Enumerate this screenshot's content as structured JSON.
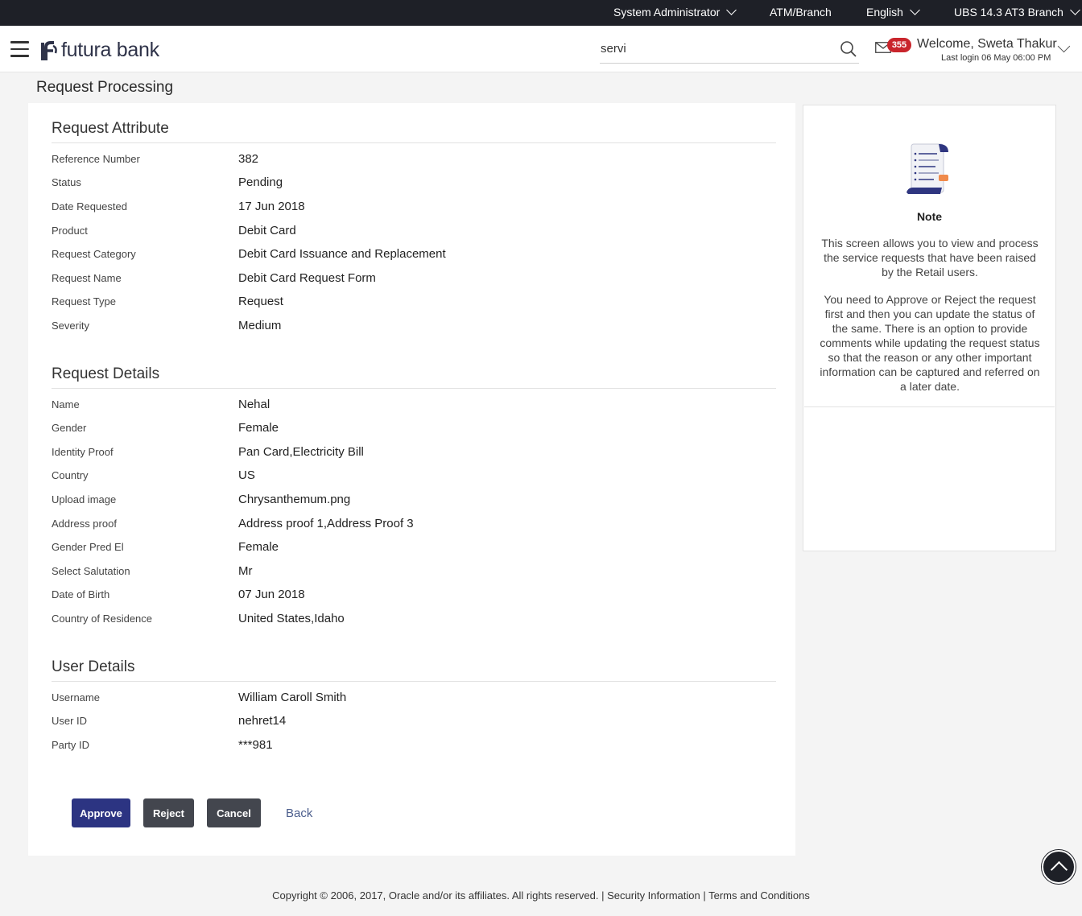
{
  "topbar": {
    "role": "System Administrator",
    "entity": "ATM/Branch",
    "language": "English",
    "branch": "UBS 14.3 AT3 Branch"
  },
  "header": {
    "logo_text": "futura bank",
    "search_value": "servi",
    "mail_count": "355",
    "welcome": "Welcome, Sweta Thakur",
    "last_login": "Last login 06 May 06:00 PM"
  },
  "page": {
    "title": "Request Processing"
  },
  "request_attribute": {
    "title": "Request Attribute",
    "rows": [
      {
        "label": "Reference Number",
        "value": "382"
      },
      {
        "label": "Status",
        "value": "Pending"
      },
      {
        "label": "Date Requested",
        "value": "17 Jun 2018"
      },
      {
        "label": "Product",
        "value": "Debit Card"
      },
      {
        "label": "Request Category",
        "value": "Debit Card Issuance and Replacement"
      },
      {
        "label": "Request Name",
        "value": "Debit Card Request Form"
      },
      {
        "label": "Request Type",
        "value": "Request"
      },
      {
        "label": "Severity",
        "value": "Medium"
      }
    ]
  },
  "request_details": {
    "title": "Request Details",
    "rows": [
      {
        "label": "Name",
        "value": "Nehal"
      },
      {
        "label": "Gender",
        "value": "Female"
      },
      {
        "label": "Identity Proof",
        "value": "Pan Card,Electricity Bill"
      },
      {
        "label": "Country",
        "value": "US"
      },
      {
        "label": "Upload image",
        "value": "Chrysanthemum.png"
      },
      {
        "label": "Address proof",
        "value": "Address proof 1,Address Proof 3"
      },
      {
        "label": "Gender Pred El",
        "value": "Female"
      },
      {
        "label": "Select Salutation",
        "value": "Mr"
      },
      {
        "label": "Date of Birth",
        "value": "07 Jun 2018"
      },
      {
        "label": "Country of Residence",
        "value": "United States,Idaho"
      }
    ]
  },
  "user_details": {
    "title": "User Details",
    "rows": [
      {
        "label": "Username",
        "value": "William Caroll Smith"
      },
      {
        "label": "User ID",
        "value": "nehret14"
      },
      {
        "label": "Party ID",
        "value": "***981"
      }
    ]
  },
  "actions": {
    "approve": "Approve",
    "reject": "Reject",
    "cancel": "Cancel",
    "back": "Back"
  },
  "note": {
    "title": "Note",
    "paragraph1": "This screen allows you to view and process the service requests that have been raised by the Retail users.",
    "paragraph2": "You need to Approve or Reject the request first and then you can update the status of the same. There is an option to provide comments while updating the request status so that the reason or any other important information can be captured and referred on a later date."
  },
  "footer": {
    "copyright": "Copyright © 2006, 2017, Oracle and/or its affiliates. All rights reserved.",
    "security": "Security Information",
    "terms": "Terms and Conditions"
  },
  "colors": {
    "topbar": "#1e2027",
    "approve": "#2c3482",
    "secondary_button": "#43464e",
    "badge": "#c9252c"
  }
}
